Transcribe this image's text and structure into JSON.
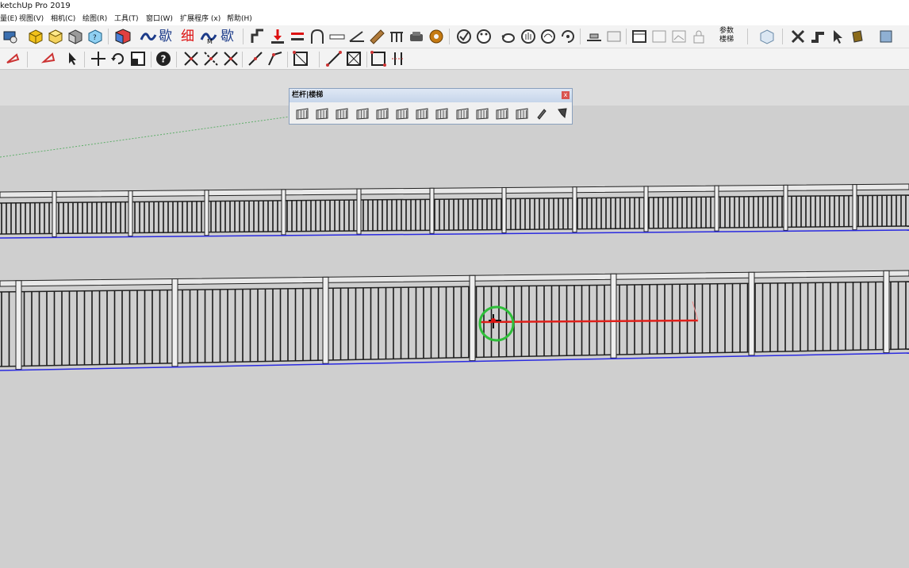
{
  "window": {
    "title": "ketchUp Pro 2019"
  },
  "menu": [
    {
      "label": "量(E)"
    },
    {
      "label": "视图(V)"
    },
    {
      "label": "相机(C)"
    },
    {
      "label": "绘图(R)"
    },
    {
      "label": "工具(T)"
    },
    {
      "label": "窗口(W)"
    },
    {
      "label": "扩展程序 (x)"
    },
    {
      "label": "帮助(H)"
    }
  ],
  "toolbar1": {
    "text_tools": {
      "kuan": "歇",
      "xi": "细",
      "kuan2": "歇"
    },
    "stair_param": {
      "line1": "参数",
      "line2": "楼梯"
    }
  },
  "panel": {
    "title": "栏杆|楼梯",
    "close_label": "x"
  },
  "colors": {
    "canvas_bg": "#cfcfcf",
    "red_axis": "#e0201a",
    "green_axis": "#3daa4a",
    "blue_axis": "#2a2ae0",
    "rail": "#222222"
  }
}
